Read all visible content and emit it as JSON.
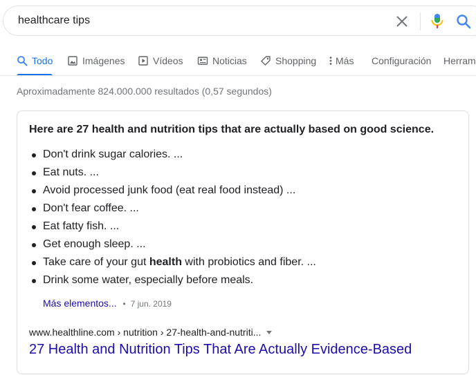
{
  "search": {
    "query": "healthcare tips"
  },
  "tabs": [
    {
      "label": "Todo",
      "icon": "search-icon"
    },
    {
      "label": "Imágenes",
      "icon": "image-icon"
    },
    {
      "label": "Vídeos",
      "icon": "video-icon"
    },
    {
      "label": "Noticias",
      "icon": "news-icon"
    },
    {
      "label": "Shopping",
      "icon": "tag-icon"
    },
    {
      "label": "Más",
      "icon": "more-vert-icon"
    },
    {
      "label": "Configuración"
    },
    {
      "label": "Herramientas"
    }
  ],
  "results_stats": "Aproximadamente 824.000.000 resultados (0,57 segundos)",
  "featured_snippet": {
    "heading": "Here are 27 health and nutrition tips that are actually based on good science.",
    "items": [
      {
        "text": "Don't drink sugar calories. ..."
      },
      {
        "text": "Eat nuts. ..."
      },
      {
        "text": "Avoid processed junk food (eat real food instead) ..."
      },
      {
        "text": "Don't fear coffee. ..."
      },
      {
        "text": "Eat fatty fish. ..."
      },
      {
        "text": "Get enough sleep. ..."
      },
      {
        "pre": "Take care of your gut ",
        "bold": "health",
        "post": " with probiotics and fiber. ..."
      },
      {
        "text": "Drink some water, especially before meals."
      }
    ],
    "more_label": "Más elementos...",
    "separator": "•",
    "date": "7 jun. 2019",
    "source_url": "www.healthline.com › nutrition › 27-health-and-nutriti...",
    "result_title": "27 Health and Nutrition Tips That Are Actually Evidence-Based"
  },
  "colors": {
    "accent": "#1a73e8",
    "link": "#1a0dab",
    "muted": "#70757a"
  }
}
